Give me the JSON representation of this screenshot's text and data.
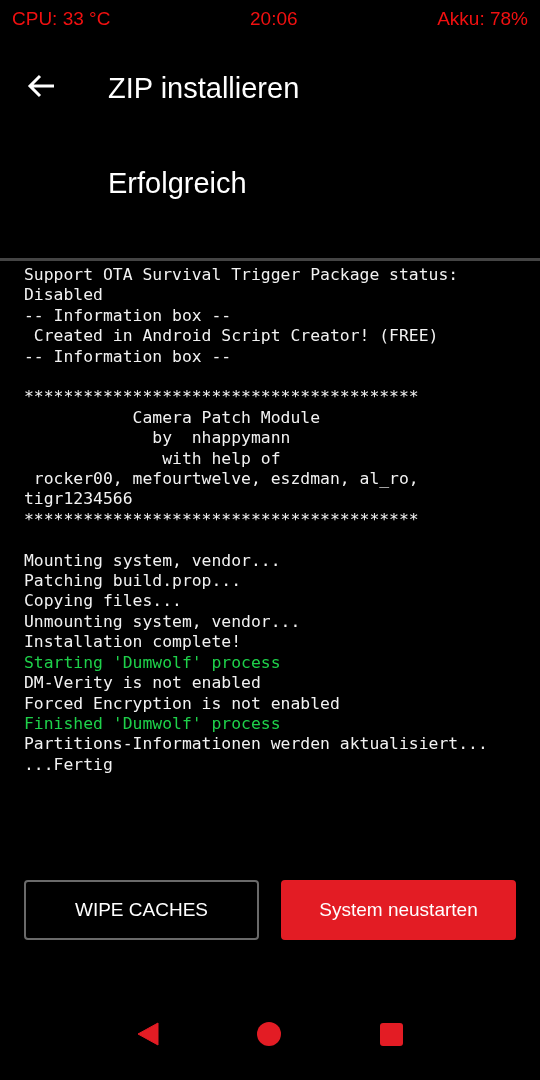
{
  "status_bar": {
    "cpu": "CPU: 33 °C",
    "time": "20:06",
    "battery": "Akku: 78%"
  },
  "header": {
    "title": "ZIP installieren",
    "subtitle": "Erfolgreich"
  },
  "log": [
    {
      "kind": "plain",
      "text": "Support OTA Survival Trigger Package status:"
    },
    {
      "kind": "plain",
      "text": "Disabled"
    },
    {
      "kind": "plain",
      "text": "-- Information box --"
    },
    {
      "kind": "plain",
      "text": " Created in Android Script Creator! (FREE)"
    },
    {
      "kind": "plain",
      "text": "-- Information box --"
    },
    {
      "kind": "blank"
    },
    {
      "kind": "plain",
      "text": "****************************************"
    },
    {
      "kind": "plain",
      "text": "           Camera Patch Module"
    },
    {
      "kind": "plain",
      "text": "             by  nhappymann"
    },
    {
      "kind": "plain",
      "text": "              with help of"
    },
    {
      "kind": "plain",
      "text": " rocker00, mefourtwelve, eszdman, al_ro,"
    },
    {
      "kind": "plain",
      "text": "tigr1234566"
    },
    {
      "kind": "plain",
      "text": "****************************************"
    },
    {
      "kind": "blank"
    },
    {
      "kind": "plain",
      "text": "Mounting system, vendor..."
    },
    {
      "kind": "plain",
      "text": "Patching build.prop..."
    },
    {
      "kind": "plain",
      "text": "Copying files..."
    },
    {
      "kind": "plain",
      "text": "Unmounting system, vendor..."
    },
    {
      "kind": "plain",
      "text": "Installation complete!"
    },
    {
      "kind": "highlight",
      "text": "Starting 'Dumwolf' process"
    },
    {
      "kind": "plain",
      "text": "DM-Verity is not enabled"
    },
    {
      "kind": "plain",
      "text": "Forced Encryption is not enabled"
    },
    {
      "kind": "highlight",
      "text": "Finished 'Dumwolf' process"
    },
    {
      "kind": "plain",
      "text": "Partitions-Informationen werden aktualisiert..."
    },
    {
      "kind": "plain",
      "text": "...Fertig"
    }
  ],
  "buttons": [
    {
      "kind": "outline",
      "label": "WIPE CACHES"
    },
    {
      "kind": "primary",
      "label": "System neustarten"
    }
  ]
}
